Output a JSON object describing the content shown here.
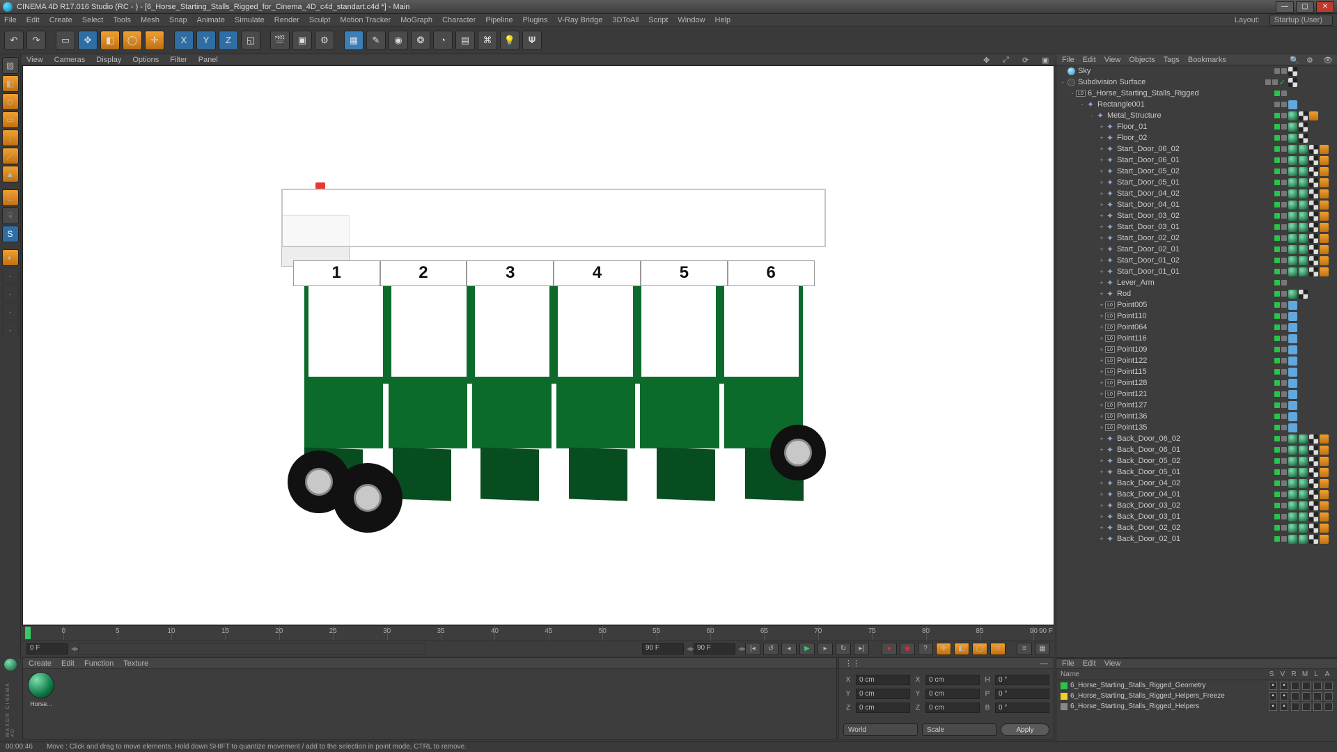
{
  "titlebar": {
    "text": "CINEMA 4D R17.016 Studio (RC - ) - [6_Horse_Starting_Stalls_Rigged_for_Cinema_4D_c4d_standart.c4d *] - Main"
  },
  "mainmenu": {
    "items": [
      "File",
      "Edit",
      "Create",
      "Select",
      "Tools",
      "Mesh",
      "Snap",
      "Animate",
      "Simulate",
      "Render",
      "Sculpt",
      "Motion Tracker",
      "MoGraph",
      "Character",
      "Pipeline",
      "Plugins",
      "V-Ray Bridge",
      "3DToAll",
      "Script",
      "Window",
      "Help"
    ],
    "layout_label": "Layout:",
    "layout_value": "Startup (User)"
  },
  "viewport_menu": {
    "items": [
      "View",
      "Cameras",
      "Display",
      "Options",
      "Filter",
      "Panel"
    ]
  },
  "gate_numbers": [
    "1",
    "2",
    "3",
    "4",
    "5",
    "6"
  ],
  "timeline": {
    "ticks": [
      0,
      5,
      10,
      15,
      20,
      25,
      30,
      35,
      40,
      45,
      50,
      55,
      60,
      65,
      70,
      75,
      80,
      85,
      90
    ],
    "end_label": "90 F",
    "current": "0 F",
    "range_end": "90 F",
    "range_end2": "90 F"
  },
  "material_panel": {
    "menu": [
      "Create",
      "Edit",
      "Function",
      "Texture"
    ],
    "mat_name": "Horse..."
  },
  "coord": {
    "labels": {
      "x": "X",
      "y": "Y",
      "z": "Z",
      "x2": "X",
      "y2": "Y",
      "z2": "Z",
      "h": "H",
      "p": "P",
      "b": "B"
    },
    "vals": {
      "x": "0 cm",
      "y": "0 cm",
      "z": "0 cm",
      "x2": "0 cm",
      "y2": "0 cm",
      "z2": "0 cm",
      "h": "0 °",
      "p": "0 °",
      "b": "0 °"
    },
    "world": "World",
    "scale": "Scale",
    "apply": "Apply"
  },
  "obj_menu": {
    "items": [
      "File",
      "Edit",
      "View",
      "Objects",
      "Tags",
      "Bookmarks"
    ]
  },
  "tree": [
    {
      "d": 0,
      "e": "",
      "ic": "sky",
      "n": "Sky",
      "dots": [
        "gr",
        "gr"
      ],
      "tags": [
        "chk"
      ]
    },
    {
      "d": 0,
      "e": "-",
      "ic": "sds",
      "n": "Subdivision Surface",
      "dots": [
        "gr",
        "gr"
      ],
      "tags": [
        "chk"
      ],
      "xgreen": true
    },
    {
      "d": 1,
      "e": "-",
      "ic": "lo",
      "n": "6_Horse_Starting_Stalls_Rigged",
      "dots": [
        "g",
        "gr"
      ],
      "tags": []
    },
    {
      "d": 2,
      "e": "-",
      "ic": "null",
      "n": "Rectangle001",
      "dots": [
        "gr",
        "gr"
      ],
      "tags": [
        "tri"
      ]
    },
    {
      "d": 3,
      "e": "-",
      "ic": "null",
      "n": "Metal_Structure",
      "dots": [
        "g",
        "gr"
      ],
      "tags": [
        "sph",
        "chk",
        "or"
      ]
    },
    {
      "d": 4,
      "e": "+",
      "ic": "null",
      "n": "Floor_01",
      "dots": [
        "g",
        "gr"
      ],
      "tags": [
        "sph",
        "chk"
      ]
    },
    {
      "d": 4,
      "e": "+",
      "ic": "null",
      "n": "Floor_02",
      "dots": [
        "g",
        "gr"
      ],
      "tags": [
        "sph",
        "chk"
      ]
    },
    {
      "d": 4,
      "e": "+",
      "ic": "null",
      "n": "Start_Door_06_02",
      "dots": [
        "g",
        "gr"
      ],
      "tags": [
        "sph",
        "sph",
        "chk",
        "or"
      ]
    },
    {
      "d": 4,
      "e": "+",
      "ic": "null",
      "n": "Start_Door_06_01",
      "dots": [
        "g",
        "gr"
      ],
      "tags": [
        "sph",
        "sph",
        "chk",
        "or"
      ]
    },
    {
      "d": 4,
      "e": "+",
      "ic": "null",
      "n": "Start_Door_05_02",
      "dots": [
        "g",
        "gr"
      ],
      "tags": [
        "sph",
        "sph",
        "chk",
        "or"
      ]
    },
    {
      "d": 4,
      "e": "+",
      "ic": "null",
      "n": "Start_Door_05_01",
      "dots": [
        "g",
        "gr"
      ],
      "tags": [
        "sph",
        "sph",
        "chk",
        "or"
      ]
    },
    {
      "d": 4,
      "e": "+",
      "ic": "null",
      "n": "Start_Door_04_02",
      "dots": [
        "g",
        "gr"
      ],
      "tags": [
        "sph",
        "sph",
        "chk",
        "or"
      ]
    },
    {
      "d": 4,
      "e": "+",
      "ic": "null",
      "n": "Start_Door_04_01",
      "dots": [
        "g",
        "gr"
      ],
      "tags": [
        "sph",
        "sph",
        "chk",
        "or"
      ]
    },
    {
      "d": 4,
      "e": "+",
      "ic": "null",
      "n": "Start_Door_03_02",
      "dots": [
        "g",
        "gr"
      ],
      "tags": [
        "sph",
        "sph",
        "chk",
        "or"
      ]
    },
    {
      "d": 4,
      "e": "+",
      "ic": "null",
      "n": "Start_Door_03_01",
      "dots": [
        "g",
        "gr"
      ],
      "tags": [
        "sph",
        "sph",
        "chk",
        "or"
      ]
    },
    {
      "d": 4,
      "e": "+",
      "ic": "null",
      "n": "Start_Door_02_02",
      "dots": [
        "g",
        "gr"
      ],
      "tags": [
        "sph",
        "sph",
        "chk",
        "or"
      ]
    },
    {
      "d": 4,
      "e": "+",
      "ic": "null",
      "n": "Start_Door_02_01",
      "dots": [
        "g",
        "gr"
      ],
      "tags": [
        "sph",
        "sph",
        "chk",
        "or"
      ]
    },
    {
      "d": 4,
      "e": "+",
      "ic": "null",
      "n": "Start_Door_01_02",
      "dots": [
        "g",
        "gr"
      ],
      "tags": [
        "sph",
        "sph",
        "chk",
        "or"
      ]
    },
    {
      "d": 4,
      "e": "+",
      "ic": "null",
      "n": "Start_Door_01_01",
      "dots": [
        "g",
        "gr"
      ],
      "tags": [
        "sph",
        "sph",
        "chk",
        "or"
      ]
    },
    {
      "d": 4,
      "e": "+",
      "ic": "null",
      "n": "Lever_Arm",
      "dots": [
        "g",
        "gr"
      ],
      "tags": []
    },
    {
      "d": 4,
      "e": "+",
      "ic": "null",
      "n": "Rod",
      "dots": [
        "g",
        "gr"
      ],
      "tags": [
        "sph",
        "chk"
      ]
    },
    {
      "d": 4,
      "e": "+",
      "ic": "lo",
      "n": "Point005",
      "dots": [
        "g",
        "gr"
      ],
      "tags": [
        "tri"
      ]
    },
    {
      "d": 4,
      "e": "+",
      "ic": "lo",
      "n": "Point110",
      "dots": [
        "g",
        "gr"
      ],
      "tags": [
        "tri"
      ]
    },
    {
      "d": 4,
      "e": "+",
      "ic": "lo",
      "n": "Point064",
      "dots": [
        "g",
        "gr"
      ],
      "tags": [
        "tri"
      ]
    },
    {
      "d": 4,
      "e": "+",
      "ic": "lo",
      "n": "Point116",
      "dots": [
        "g",
        "gr"
      ],
      "tags": [
        "tri"
      ]
    },
    {
      "d": 4,
      "e": "+",
      "ic": "lo",
      "n": "Point109",
      "dots": [
        "g",
        "gr"
      ],
      "tags": [
        "tri"
      ]
    },
    {
      "d": 4,
      "e": "+",
      "ic": "lo",
      "n": "Point122",
      "dots": [
        "g",
        "gr"
      ],
      "tags": [
        "tri"
      ]
    },
    {
      "d": 4,
      "e": "+",
      "ic": "lo",
      "n": "Point115",
      "dots": [
        "g",
        "gr"
      ],
      "tags": [
        "tri"
      ]
    },
    {
      "d": 4,
      "e": "+",
      "ic": "lo",
      "n": "Point128",
      "dots": [
        "g",
        "gr"
      ],
      "tags": [
        "tri"
      ]
    },
    {
      "d": 4,
      "e": "+",
      "ic": "lo",
      "n": "Point121",
      "dots": [
        "g",
        "gr"
      ],
      "tags": [
        "tri"
      ]
    },
    {
      "d": 4,
      "e": "+",
      "ic": "lo",
      "n": "Point127",
      "dots": [
        "g",
        "gr"
      ],
      "tags": [
        "tri"
      ]
    },
    {
      "d": 4,
      "e": "+",
      "ic": "lo",
      "n": "Point136",
      "dots": [
        "g",
        "gr"
      ],
      "tags": [
        "tri"
      ]
    },
    {
      "d": 4,
      "e": "+",
      "ic": "lo",
      "n": "Point135",
      "dots": [
        "g",
        "gr"
      ],
      "tags": [
        "tri"
      ]
    },
    {
      "d": 4,
      "e": "+",
      "ic": "null",
      "n": "Back_Door_06_02",
      "dots": [
        "g",
        "gr"
      ],
      "tags": [
        "sph",
        "sph",
        "chk",
        "or"
      ]
    },
    {
      "d": 4,
      "e": "+",
      "ic": "null",
      "n": "Back_Door_06_01",
      "dots": [
        "g",
        "gr"
      ],
      "tags": [
        "sph",
        "sph",
        "chk",
        "or"
      ]
    },
    {
      "d": 4,
      "e": "+",
      "ic": "null",
      "n": "Back_Door_05_02",
      "dots": [
        "g",
        "gr"
      ],
      "tags": [
        "sph",
        "sph",
        "chk",
        "or"
      ]
    },
    {
      "d": 4,
      "e": "+",
      "ic": "null",
      "n": "Back_Door_05_01",
      "dots": [
        "g",
        "gr"
      ],
      "tags": [
        "sph",
        "sph",
        "chk",
        "or"
      ]
    },
    {
      "d": 4,
      "e": "+",
      "ic": "null",
      "n": "Back_Door_04_02",
      "dots": [
        "g",
        "gr"
      ],
      "tags": [
        "sph",
        "sph",
        "chk",
        "or"
      ]
    },
    {
      "d": 4,
      "e": "+",
      "ic": "null",
      "n": "Back_Door_04_01",
      "dots": [
        "g",
        "gr"
      ],
      "tags": [
        "sph",
        "sph",
        "chk",
        "or"
      ]
    },
    {
      "d": 4,
      "e": "+",
      "ic": "null",
      "n": "Back_Door_03_02",
      "dots": [
        "g",
        "gr"
      ],
      "tags": [
        "sph",
        "sph",
        "chk",
        "or"
      ]
    },
    {
      "d": 4,
      "e": "+",
      "ic": "null",
      "n": "Back_Door_03_01",
      "dots": [
        "g",
        "gr"
      ],
      "tags": [
        "sph",
        "sph",
        "chk",
        "or"
      ]
    },
    {
      "d": 4,
      "e": "+",
      "ic": "null",
      "n": "Back_Door_02_02",
      "dots": [
        "g",
        "gr"
      ],
      "tags": [
        "sph",
        "sph",
        "chk",
        "or"
      ]
    },
    {
      "d": 4,
      "e": "+",
      "ic": "null",
      "n": "Back_Door_02_01",
      "dots": [
        "g",
        "gr"
      ],
      "tags": [
        "sph",
        "sph",
        "chk",
        "or"
      ]
    }
  ],
  "attr_menu": {
    "items": [
      "File",
      "Edit",
      "View"
    ]
  },
  "attr_header": {
    "name": "Name",
    "cols": [
      "S",
      "V",
      "R",
      "M",
      "L",
      "A"
    ]
  },
  "layers": [
    {
      "c": "grn",
      "n": "6_Horse_Starting_Stalls_Rigged_Geometry"
    },
    {
      "c": "yel",
      "n": "6_Horse_Starting_Stalls_Rigged_Helpers_Freeze"
    },
    {
      "c": "gry",
      "n": "6_Horse_Starting_Stalls_Rigged_Helpers"
    }
  ],
  "status": {
    "time": "00:00:46",
    "hint": "Move : Click and drag to move elements. Hold down SHIFT to quantize movement / add to the selection in point mode, CTRL to remove."
  },
  "brand": "MAXON  CINEMA 4D"
}
